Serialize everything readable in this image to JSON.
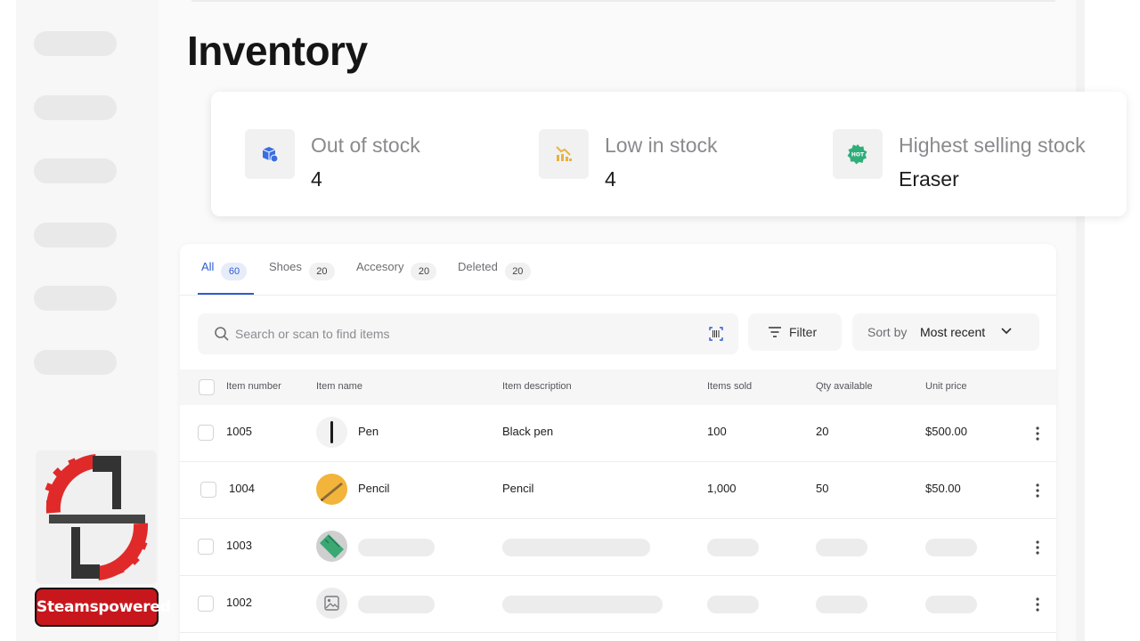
{
  "page": {
    "title": "Inventory"
  },
  "sidebar": {
    "items": [
      {},
      {},
      {},
      {},
      {},
      {}
    ]
  },
  "stats": [
    {
      "label": "Out of stock",
      "value": "4",
      "icon": "box-icon",
      "color": "#3b6ee0"
    },
    {
      "label": "Low in stock",
      "value": "4",
      "icon": "chart-down-icon",
      "color": "#e8b33a"
    },
    {
      "label": "Highest selling stock",
      "value": "Eraser",
      "icon": "hot-badge-icon",
      "color": "#2fae7a"
    }
  ],
  "tabs": [
    {
      "label": "All",
      "count": "60",
      "active": true
    },
    {
      "label": "Shoes",
      "count": "20"
    },
    {
      "label": "Accesory",
      "count": "20"
    },
    {
      "label": "Deleted",
      "count": "20"
    }
  ],
  "toolbar": {
    "search_placeholder": "Search or scan to find items",
    "filter_label": "Filter",
    "sort_prefix": "Sort by",
    "sort_value": "Most recent"
  },
  "table": {
    "columns": [
      "Item number",
      "Item name",
      "Item description",
      "Items sold",
      "Qty available",
      "Unit price"
    ],
    "rows": [
      {
        "number": "1005",
        "name": "Pen",
        "description": "Black pen",
        "sold": "100",
        "qty": "20",
        "price": "$500.00",
        "thumb": "pen"
      },
      {
        "number": "1004",
        "name": "Pencil",
        "description": "Pencil",
        "sold": "1,000",
        "qty": "50",
        "price": "$50.00",
        "thumb": "pencil"
      },
      {
        "number": "1003",
        "loading": true,
        "thumb": "ruler"
      },
      {
        "number": "1002",
        "loading": true,
        "thumb": "image-placeholder"
      }
    ]
  },
  "watermark": {
    "label": "Steamspowered"
  },
  "colors": {
    "accent": "#2f5bd3",
    "watermark_red": "#c8161d"
  }
}
